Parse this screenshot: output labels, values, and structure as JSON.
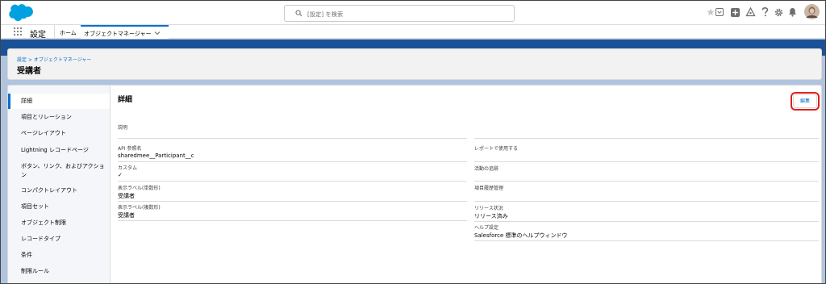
{
  "header": {
    "search_placeholder": "[設定] を検索"
  },
  "nav": {
    "app_name": "設定",
    "home_tab": "ホーム",
    "active_tab": "オブジェクトマネージャー"
  },
  "page": {
    "breadcrumb": "設定 > オブジェクトマネージャー",
    "title": "受講者"
  },
  "sidebar": {
    "items": [
      {
        "label": "詳細"
      },
      {
        "label": "項目とリレーション"
      },
      {
        "label": "ページレイアウト"
      },
      {
        "label": "Lightning レコードページ"
      },
      {
        "label": "ボタン、リンク、およびアクション"
      },
      {
        "label": "コンパクトレイアウト"
      },
      {
        "label": "項目セット"
      },
      {
        "label": "オブジェクト制限"
      },
      {
        "label": "レコードタイプ"
      },
      {
        "label": "条件"
      },
      {
        "label": "制限ルール"
      }
    ]
  },
  "detail": {
    "title": "詳細",
    "edit_label": "編集",
    "left_fields": [
      {
        "label": "説明",
        "value": ""
      },
      {
        "label": "API 参照名",
        "value": "sharedmee__Participant__c"
      },
      {
        "label": "カスタム",
        "value": "✓"
      },
      {
        "label": "表示ラベル(単数形)",
        "value": "受講者"
      },
      {
        "label": "表示ラベル(複数形)",
        "value": "受講者"
      }
    ],
    "right_fields": [
      {
        "label": "レポートで使用する",
        "value": ""
      },
      {
        "label": "活動の追跡",
        "value": ""
      },
      {
        "label": "項目履歴管理",
        "value": ""
      },
      {
        "label": "リリース状況",
        "value": "リリース済み"
      },
      {
        "label": "ヘルプ設定",
        "value": "Salesforce 標準のヘルプウィンドウ"
      }
    ]
  },
  "colors": {
    "brand_blue": "#0070d2",
    "banner_blue": "#1b5297",
    "highlight_red": "#e02020"
  }
}
